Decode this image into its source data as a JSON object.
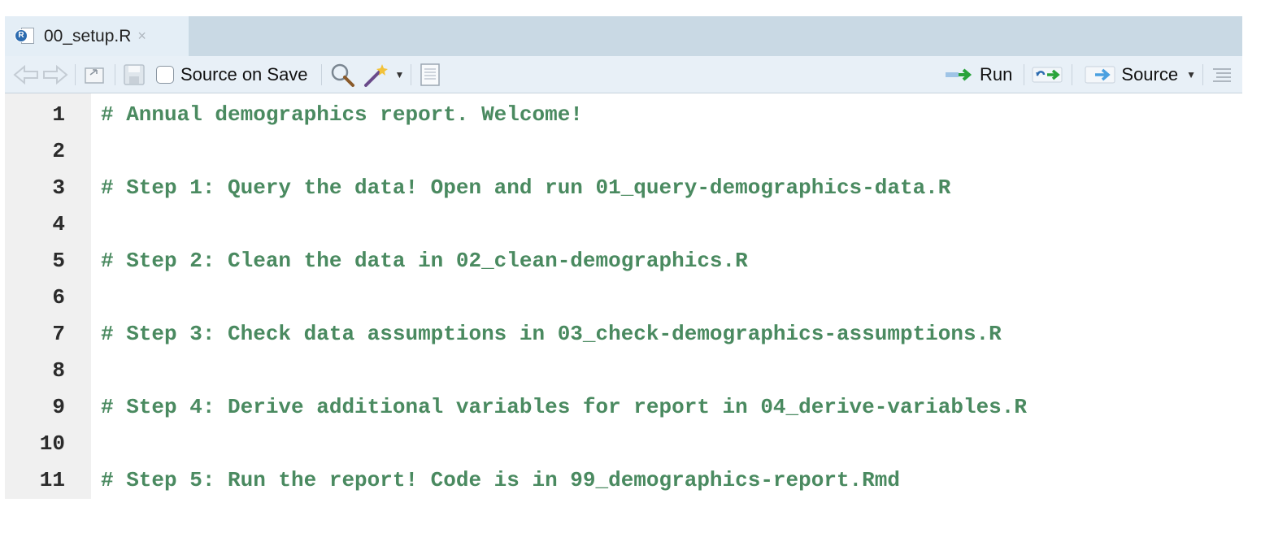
{
  "tab": {
    "filename": "00_setup.R",
    "close_symbol": "×",
    "badge": "R"
  },
  "toolbar": {
    "source_on_save_label": "Source on Save",
    "run_label": "Run",
    "source_label": "Source"
  },
  "icons": {
    "back": "back-arrow-icon",
    "forward": "forward-arrow-icon",
    "show_in_window": "show-in-window-icon",
    "save": "save-icon",
    "find": "search-icon",
    "code_tools": "magic-wand-icon",
    "compile_report": "notebook-icon",
    "rerun": "rerun-icon",
    "outline": "outline-icon"
  },
  "colors": {
    "comment": "#4a8a60",
    "accent_green": "#2aa33b",
    "accent_blue": "#3b82c4"
  },
  "code": {
    "line_numbers": [
      "1",
      "2",
      "3",
      "4",
      "5",
      "6",
      "7",
      "8",
      "9",
      "10",
      "11"
    ],
    "lines": [
      "# Annual demographics report. Welcome!",
      "",
      "# Step 1: Query the data! Open and run 01_query-demographics-data.R",
      "",
      "# Step 2: Clean the data in 02_clean-demographics.R",
      "",
      "# Step 3: Check data assumptions in 03_check-demographics-assumptions.R",
      "",
      "# Step 4: Derive additional variables for report in 04_derive-variables.R",
      "",
      "# Step 5: Run the report! Code is in 99_demographics-report.Rmd"
    ]
  }
}
